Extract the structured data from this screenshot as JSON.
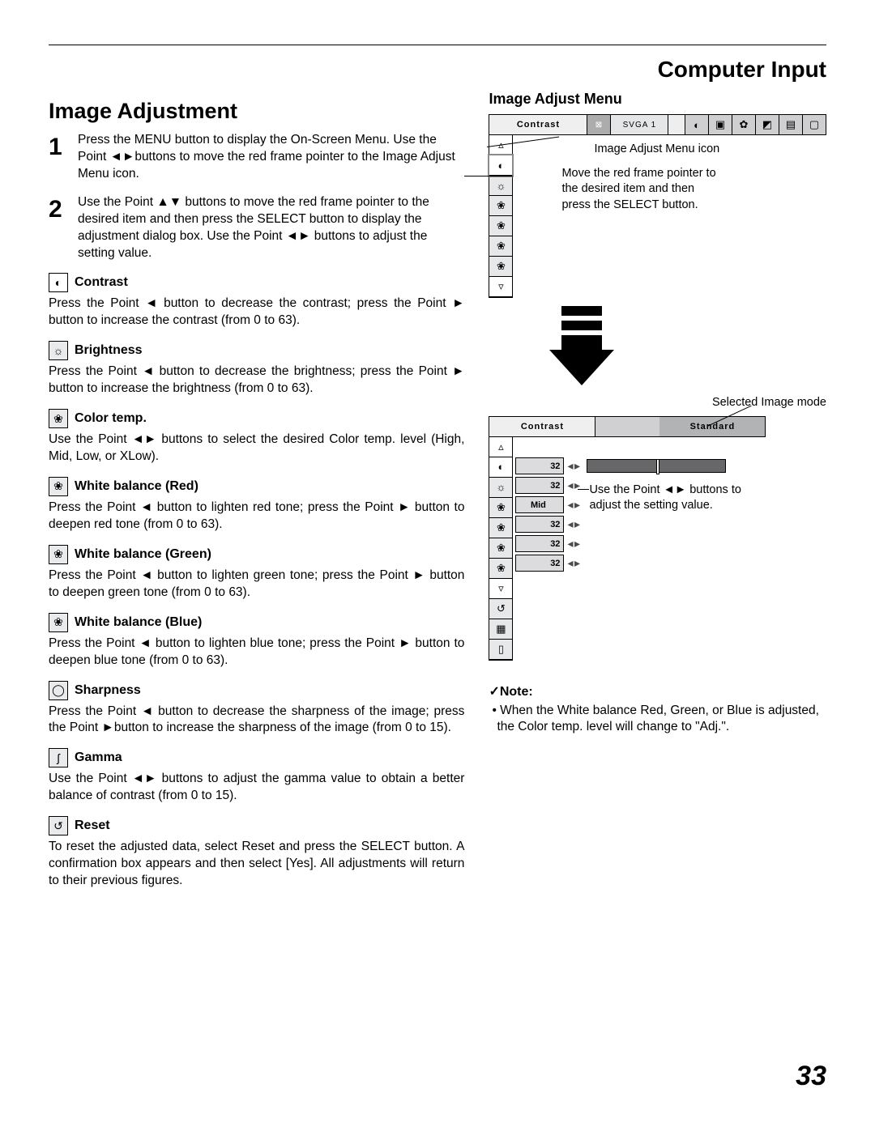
{
  "header": "Computer Input",
  "page_number": "33",
  "left": {
    "title": "Image Adjustment",
    "steps": [
      {
        "num": "1",
        "text": "Press the MENU button to display the On-Screen Menu. Use the Point ◄►buttons to move the red frame pointer to the Image Adjust Menu icon."
      },
      {
        "num": "2",
        "text": "Use the Point ▲▼ buttons to move the red frame pointer to the desired item and then press the SELECT button to display the adjustment dialog box. Use the Point ◄► buttons to adjust the setting value."
      }
    ],
    "items": [
      {
        "icon": "◐",
        "iconStyle": "white",
        "title": "Contrast",
        "body": "Press the Point ◄ button to decrease the contrast; press the Point ► button to increase the contrast (from 0 to 63)."
      },
      {
        "icon": "☼",
        "iconStyle": "gray",
        "title": "Brightness",
        "body": "Press the Point ◄ button to decrease the brightness; press the Point ► button to increase the brightness (from 0 to 63)."
      },
      {
        "icon": "❀",
        "iconStyle": "gray",
        "title": "Color temp.",
        "body": "Use the Point ◄► buttons to select the desired Color temp. level (High, Mid, Low, or XLow)."
      },
      {
        "icon": "❀",
        "iconStyle": "gray",
        "title": "White balance (Red)",
        "body": "Press the Point ◄ button to lighten red tone; press the Point ► button to deepen red tone (from 0 to 63)."
      },
      {
        "icon": "❀",
        "iconStyle": "gray",
        "title": "White balance (Green)",
        "body": "Press the Point ◄ button to lighten green tone; press the Point ► button to deepen green tone (from 0 to 63)."
      },
      {
        "icon": "❀",
        "iconStyle": "gray",
        "title": "White balance (Blue)",
        "body": "Press the Point ◄ button to lighten blue tone; press the Point ► button to deepen blue tone (from 0 to 63)."
      },
      {
        "icon": "◯",
        "iconStyle": "gray",
        "title": "Sharpness",
        "body": "Press the Point ◄ button to decrease the sharpness of the image; press the Point ►button to increase the sharpness of the image (from 0 to 15)."
      },
      {
        "icon": "ʃ",
        "iconStyle": "gray",
        "title": "Gamma",
        "body": "Use the Point ◄► buttons to adjust the gamma value to obtain a better balance of contrast (from 0 to 15)."
      },
      {
        "icon": "↺",
        "iconStyle": "gray",
        "title": "Reset",
        "body": "To reset the adjusted data, select Reset and press the SELECT button. A confirmation box appears and then select [Yes]. All adjustments will return to their previous figures."
      }
    ]
  },
  "right": {
    "heading": "Image Adjust Menu",
    "menubar_title": "Contrast",
    "menubar_signal": "SVGA  1",
    "callout_icon": "Image Adjust Menu icon",
    "callout_move": "Move the red frame pointer to the desired item and then press the SELECT button.",
    "callout_mode": "Selected Image mode",
    "menubar2_title": "Contrast",
    "menubar2_status": "Standard",
    "callout_adjust": "Use the Point ◄► buttons to adjust the setting value.",
    "adjust_values": {
      "contrast": "32",
      "brightness": "32",
      "colortemp": "Mid",
      "wb_red": "32",
      "wb_green": "32",
      "wb_blue": "32"
    },
    "note_title": "✓Note:",
    "note_body": "• When the White balance Red, Green, or Blue is adjusted, the Color temp. level will change to \"Adj.\"."
  }
}
